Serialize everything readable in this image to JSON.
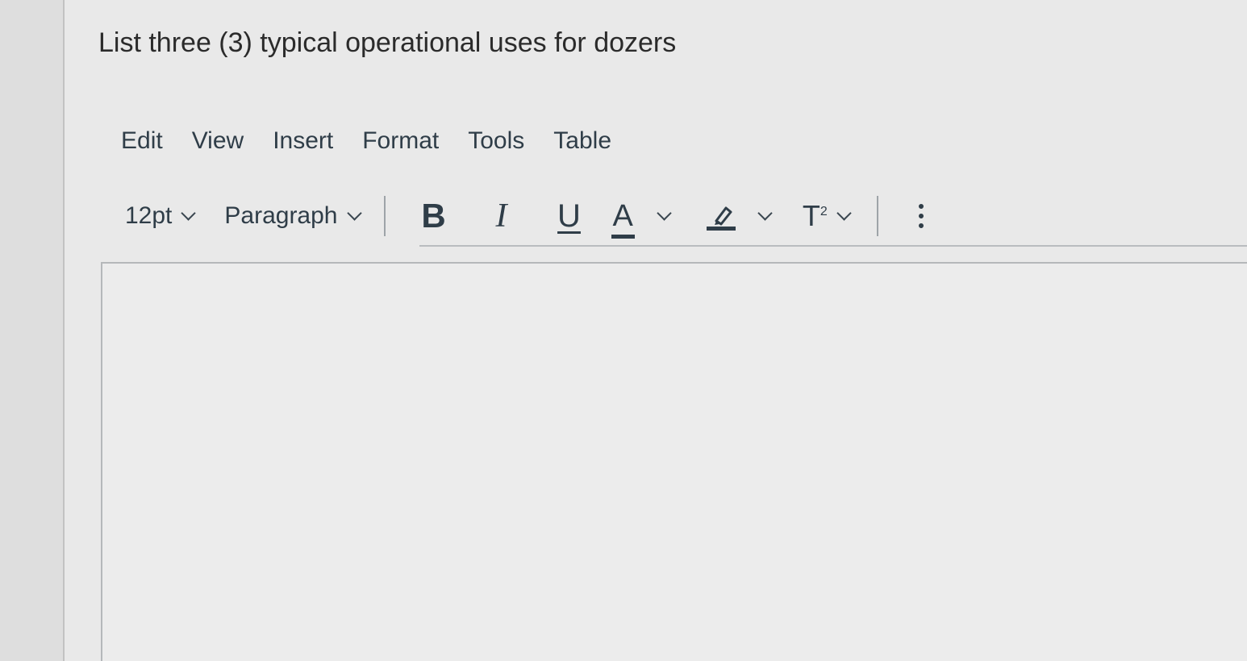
{
  "question": {
    "title": "List three (3) typical operational uses for dozers"
  },
  "menubar": {
    "items": [
      {
        "label": "Edit"
      },
      {
        "label": "View"
      },
      {
        "label": "Insert"
      },
      {
        "label": "Format"
      },
      {
        "label": "Tools"
      },
      {
        "label": "Table"
      }
    ]
  },
  "toolbar": {
    "font_size": "12pt",
    "block_format": "Paragraph",
    "bold_label": "B",
    "italic_label": "I",
    "underline_label": "U",
    "text_color_label": "A",
    "superscript_label": "T",
    "superscript_exp": "2",
    "icons": {
      "highlight": "highlighter-icon",
      "more": "more-vertical-icon"
    }
  },
  "editor": {
    "content": ""
  },
  "colors": {
    "text": "#2f3d48",
    "border": "#b5b8ba",
    "background": "#e9e9e9"
  }
}
